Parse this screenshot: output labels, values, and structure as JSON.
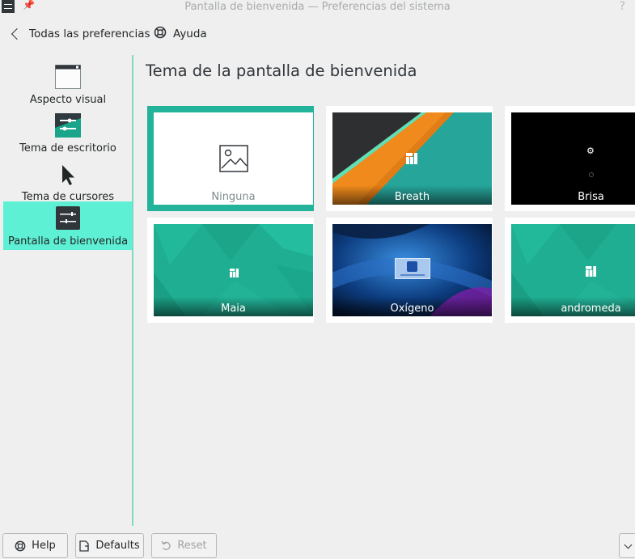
{
  "window": {
    "title": "Pantalla de bienvenida — Preferencias del sistema",
    "help_glyph": "?"
  },
  "toolbar": {
    "back_label": "Todas las preferencias",
    "help_label": "Ayuda"
  },
  "sidebar": {
    "items": [
      {
        "label": "Aspecto visual",
        "icon": "window-icon"
      },
      {
        "label": "Tema de escritorio",
        "icon": "desktop-theme-icon"
      },
      {
        "label": "Tema de cursores",
        "icon": "cursor-icon"
      },
      {
        "label": "Pantalla de bienvenida",
        "icon": "splash-settings-icon",
        "selected": true
      }
    ]
  },
  "main": {
    "heading": "Tema de la pantalla de bienvenida",
    "themes": [
      {
        "name": "Ninguna",
        "selected": true
      },
      {
        "name": "Breath"
      },
      {
        "name": "Brisa"
      },
      {
        "name": "Maia"
      },
      {
        "name": "Oxígeno"
      },
      {
        "name": "andromeda"
      }
    ]
  },
  "buttons": {
    "help": "Help",
    "defaults": "Defaults",
    "reset": "Reset"
  },
  "colors": {
    "accent": "#23b39a",
    "selection": "#5ef0d4",
    "teal_bg": "#1fae92",
    "window_bg": "#efefef"
  }
}
